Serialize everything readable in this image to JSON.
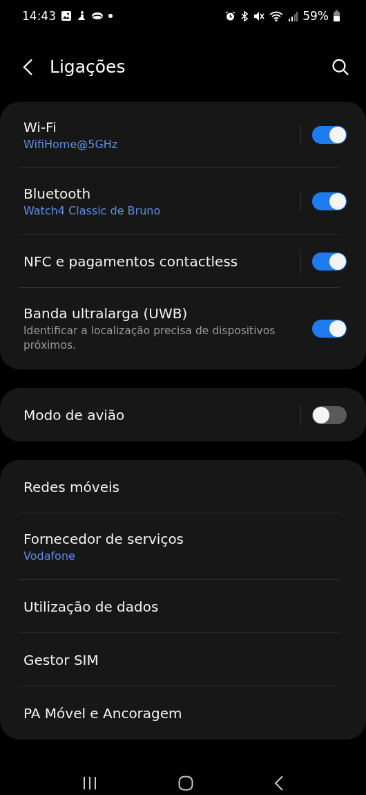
{
  "status_bar": {
    "time": "14:43",
    "battery": "59%"
  },
  "header": {
    "title": "Ligações"
  },
  "groups": [
    {
      "items": [
        {
          "title": "Wi-Fi",
          "summary": "WifiHome@5GHz",
          "on": true,
          "separator": true
        },
        {
          "title": "Bluetooth",
          "summary": "Watch4 Classic de Bruno",
          "on": true,
          "separator": true
        },
        {
          "title": "NFC e pagamentos contactless",
          "on": true,
          "separator": true
        },
        {
          "title": "Banda ultralarga (UWB)",
          "description": "Identificar a localização precisa de dispositivos próximos.",
          "on": true,
          "separator": false
        }
      ]
    },
    {
      "items": [
        {
          "title": "Modo de avião",
          "on": false,
          "separator": true
        }
      ]
    },
    {
      "items": [
        {
          "title": "Redes móveis"
        },
        {
          "title": "Fornecedor de serviços",
          "summary": "Vodafone"
        },
        {
          "title": "Utilização de dados"
        },
        {
          "title": "Gestor SIM"
        },
        {
          "title": "PA Móvel e Ancoragem"
        }
      ]
    }
  ]
}
